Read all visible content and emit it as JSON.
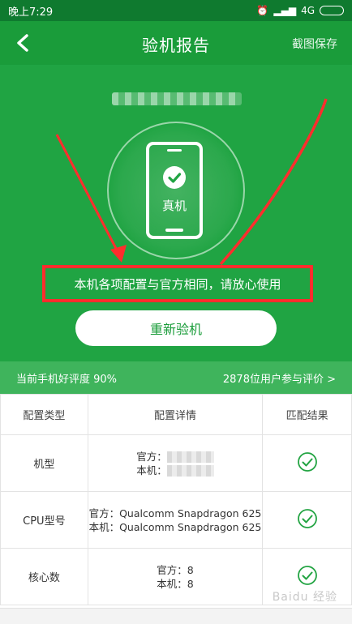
{
  "status_bar": {
    "time": "晚上7:29",
    "network": "4G"
  },
  "app_bar": {
    "title": "验机报告",
    "save_label": "截图保存"
  },
  "hero": {
    "phone_label": "真机",
    "message": "本机各项配置与官方相同，请放心使用",
    "retest_label": "重新验机"
  },
  "rating": {
    "left": "当前手机好评度 90%",
    "right": "2878位用户参与评价 >"
  },
  "table": {
    "headers": [
      "配置类型",
      "配置详情",
      "匹配结果"
    ],
    "rows": [
      {
        "type": "机型",
        "official": "官方：",
        "local": "本机："
      },
      {
        "type": "CPU型号",
        "official": "官方：Qualcomm Snapdragon 625",
        "local": "本机：Qualcomm Snapdragon 625"
      },
      {
        "type": "核心数",
        "official": "官方：8",
        "local": "本机：8"
      }
    ]
  },
  "watermark": "Baidu 经验",
  "colors": {
    "primary": "#1a9c3a",
    "hero": "#20a443",
    "highlight_box": "#ff2d2d",
    "check": "#23a443"
  }
}
